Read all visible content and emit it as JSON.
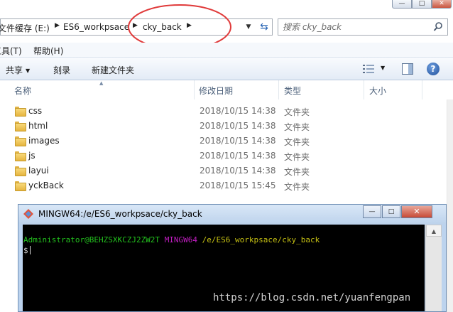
{
  "explorer": {
    "window_controls": {
      "minimize": "—",
      "maximize": "□",
      "close": "✕"
    },
    "address": {
      "crumbs": [
        "文件缓存 (E:)",
        "ES6_workpsace",
        "cky_back"
      ],
      "separator": "▶",
      "dropdown": "▼",
      "refresh": "⇆"
    },
    "search": {
      "placeholder": "搜索 cky_back"
    },
    "menu": {
      "tools": "工具(T)",
      "help": "帮助(H)"
    },
    "toolbar": {
      "share": "共享",
      "caret": "▼",
      "burn": "刻录",
      "new_folder": "新建文件夹",
      "help": "?"
    },
    "columns": {
      "name": "名称",
      "modified": "修改日期",
      "type": "类型",
      "size": "大小",
      "sort_indicator": "▲"
    },
    "files": [
      {
        "name": "css",
        "modified": "2018/10/15 14:38",
        "type": "文件夹"
      },
      {
        "name": "html",
        "modified": "2018/10/15 14:38",
        "type": "文件夹"
      },
      {
        "name": "images",
        "modified": "2018/10/15 14:38",
        "type": "文件夹"
      },
      {
        "name": "js",
        "modified": "2018/10/15 14:38",
        "type": "文件夹"
      },
      {
        "name": "layui",
        "modified": "2018/10/15 14:38",
        "type": "文件夹"
      },
      {
        "name": "yckBack",
        "modified": "2018/10/15 15:45",
        "type": "文件夹"
      }
    ]
  },
  "terminal": {
    "title": "MINGW64:/e/ES6_workpsace/cky_back",
    "controls": {
      "minimize": "—",
      "maximize": "□",
      "close": "✕"
    },
    "prompt_user": "Administrator@BEHZSXKCZJ2ZW2T",
    "prompt_env": "MINGW64",
    "prompt_path": "/e/ES6_workpsace/cky_back",
    "input_prompt": "$",
    "scroll_up": "▲",
    "scroll_down": "▼"
  },
  "watermark": "https://blog.csdn.net/yuanfengpan",
  "colors": {
    "annotation": "#e03a3a",
    "prompt_user": "#23c11e",
    "prompt_env": "#c21ec2",
    "prompt_path": "#c6c113",
    "folder": "#e6b43e"
  }
}
